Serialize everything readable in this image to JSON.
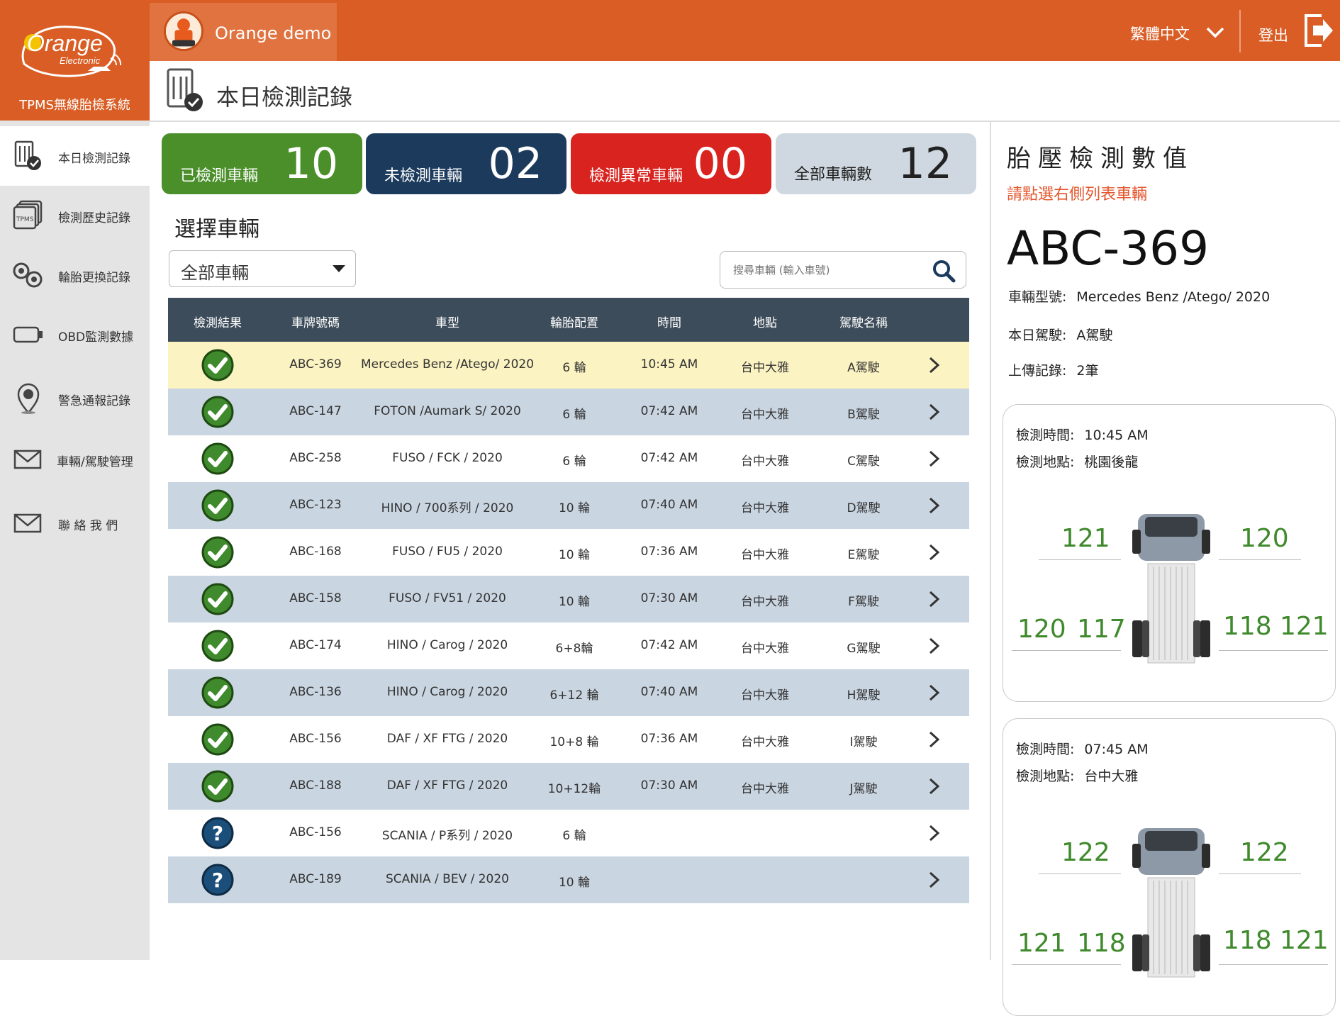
{
  "app": {
    "logo_text": "Orange",
    "logo_sub_brand": "Electronic",
    "system_name": "TPMS無線胎檢系統",
    "user_name": "Orange demo",
    "language": "繁體中文",
    "logout_label": "登出",
    "accent_color": "#d95d24"
  },
  "page": {
    "title": "本日檢測記錄"
  },
  "sidebar": {
    "items": [
      {
        "label": "本日檢測記錄",
        "icon": "checklist-icon",
        "active": true
      },
      {
        "label": "檢測歷史記錄",
        "icon": "tpms-history-icon",
        "active": false
      },
      {
        "label": "輪胎更換記錄",
        "icon": "tire-swap-icon",
        "active": false
      },
      {
        "label": "OBD監測數據",
        "icon": "obd-icon",
        "active": false
      },
      {
        "label": "警急通報記錄",
        "icon": "sos-pin-icon",
        "active": false
      },
      {
        "label": "車輛/駕駛管理",
        "icon": "mail-icon",
        "active": false
      },
      {
        "label": "聯 絡 我 們",
        "icon": "mail-icon",
        "active": false
      }
    ]
  },
  "stats": {
    "done": {
      "label": "已檢測車輛",
      "value": "10",
      "color": "#4a8f2a"
    },
    "pending": {
      "label": "未檢測車輛",
      "value": "02",
      "color": "#1b3a5c"
    },
    "abnormal": {
      "label": "檢測異常車輛",
      "value": "00",
      "color": "#d9231f"
    },
    "all": {
      "label": "全部車輛數",
      "value": "12",
      "color": "#cfd8e0"
    }
  },
  "selector": {
    "title": "選擇車輛",
    "selected": "全部車輛",
    "search_placeholder": "搜尋車輛 (輸入車號)"
  },
  "table": {
    "columns": [
      "檢測結果",
      "車牌號碼",
      "車型",
      "輪胎配置",
      "時間",
      "地點",
      "駕駛名稱"
    ],
    "rows": [
      {
        "status": "ok",
        "plate": "ABC-369",
        "model": "Mercedes Benz /Atego/ 2020",
        "tires": "6 輪",
        "time": "10:45 AM",
        "location": "台中大雅",
        "driver": "A駕駛"
      },
      {
        "status": "ok",
        "plate": "ABC-147",
        "model": "FOTON /Aumark S/ 2020",
        "tires": "6 輪",
        "time": "07:42 AM",
        "location": "台中大雅",
        "driver": "B駕駛"
      },
      {
        "status": "ok",
        "plate": "ABC-258",
        "model": "FUSO / FCK / 2020",
        "tires": "6 輪",
        "time": "07:42 AM",
        "location": "台中大雅",
        "driver": "C駕駛"
      },
      {
        "status": "ok",
        "plate": "ABC-123",
        "model": "HINO / 700系列 / 2020",
        "tires": "10 輪",
        "time": "07:40 AM",
        "location": "台中大雅",
        "driver": "D駕駛"
      },
      {
        "status": "ok",
        "plate": "ABC-168",
        "model": "FUSO / FU5 / 2020",
        "tires": "10 輪",
        "time": "07:36 AM",
        "location": "台中大雅",
        "driver": "E駕駛"
      },
      {
        "status": "ok",
        "plate": "ABC-158",
        "model": "FUSO / FV51 / 2020",
        "tires": "10 輪",
        "time": "07:30 AM",
        "location": "台中大雅",
        "driver": "F駕駛"
      },
      {
        "status": "ok",
        "plate": "ABC-174",
        "model": "HINO / Carog / 2020",
        "tires": "6+8輪",
        "time": "07:42 AM",
        "location": "台中大雅",
        "driver": "G駕駛"
      },
      {
        "status": "ok",
        "plate": "ABC-136",
        "model": "HINO / Carog / 2020",
        "tires": "6+12 輪",
        "time": "07:40 AM",
        "location": "台中大雅",
        "driver": "H駕駛"
      },
      {
        "status": "ok",
        "plate": "ABC-156",
        "model": "DAF / XF FTG / 2020",
        "tires": "10+8 輪",
        "time": "07:36 AM",
        "location": "台中大雅",
        "driver": "I駕駛"
      },
      {
        "status": "ok",
        "plate": "ABC-188",
        "model": "DAF / XF FTG / 2020",
        "tires": "10+12輪",
        "time": "07:30 AM",
        "location": "台中大雅",
        "driver": "J駕駛"
      },
      {
        "status": "unknown",
        "plate": "ABC-156",
        "model": "SCANIA / P系列 / 2020",
        "tires": "6 輪",
        "time": "",
        "location": "",
        "driver": ""
      },
      {
        "status": "unknown",
        "plate": "ABC-189",
        "model": "SCANIA / BEV / 2020",
        "tires": "10 輪",
        "time": "",
        "location": "",
        "driver": ""
      }
    ]
  },
  "detail": {
    "title": "胎壓檢測數值",
    "hint": "請點選右側列表車輛",
    "plate": "ABC-369",
    "model_label": "車輛型號:",
    "model": "Mercedes Benz /Atego/ 2020",
    "driver_label": "本日駕駛:",
    "driver": "A駕駛",
    "uploads_label": "上傳記錄:",
    "uploads": "2筆",
    "time_label": "檢測時間:",
    "location_label": "檢測地點:",
    "records": [
      {
        "time": "10:45 AM",
        "location": "桃園後龍",
        "pressures": {
          "front_left": "121",
          "front_right": "120",
          "rear_left_outer": "120",
          "rear_left_inner": "117",
          "rear_right_inner": "118",
          "rear_right_outer": "121"
        }
      },
      {
        "time": "07:45 AM",
        "location": "台中大雅",
        "pressures": {
          "front_left": "122",
          "front_right": "122",
          "rear_left_outer": "121",
          "rear_left_inner": "118",
          "rear_right_inner": "118",
          "rear_right_outer": "121"
        }
      }
    ]
  }
}
